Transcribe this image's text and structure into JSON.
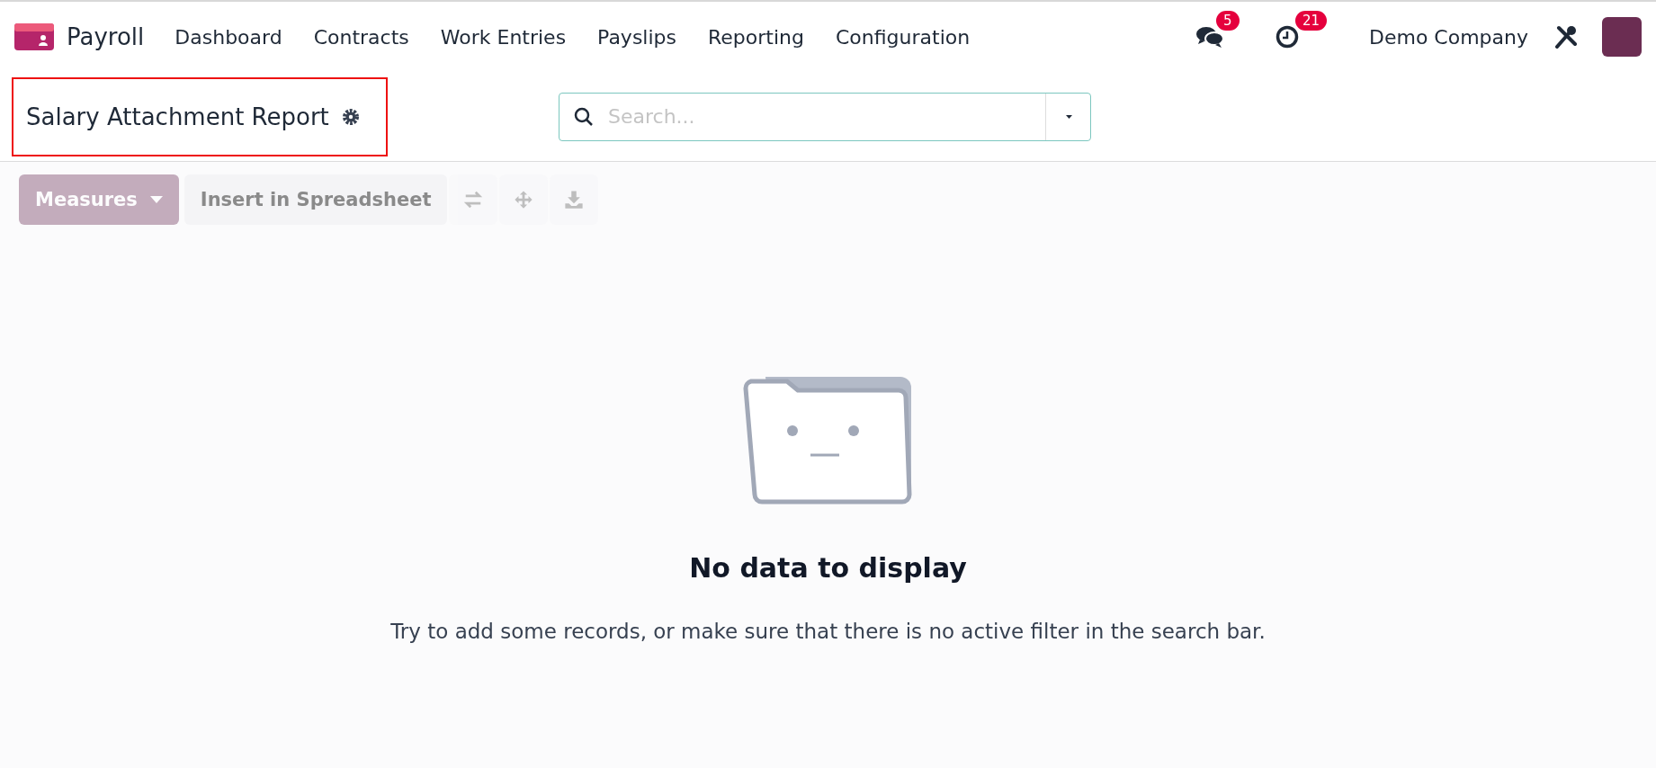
{
  "navbar": {
    "app_name": "Payroll",
    "menu": [
      "Dashboard",
      "Contracts",
      "Work Entries",
      "Payslips",
      "Reporting",
      "Configuration"
    ],
    "messages_badge": "5",
    "activities_badge": "21",
    "company": "Demo Company"
  },
  "control_panel": {
    "title": "Salary Attachment Report",
    "highlighted": true,
    "search": {
      "placeholder": "Search..."
    }
  },
  "toolbar": [
    {
      "kind": "dropdown",
      "label": "Measures",
      "disabled": true
    },
    {
      "kind": "text",
      "label": "Insert in Spreadsheet",
      "disabled": true
    },
    {
      "kind": "swap",
      "disabled": true
    },
    {
      "kind": "move",
      "disabled": true
    },
    {
      "kind": "download",
      "disabled": true
    }
  ],
  "empty_state": {
    "title": "No data to display",
    "message": "Try to add some records, or make sure that there is no active filter in the search bar."
  }
}
